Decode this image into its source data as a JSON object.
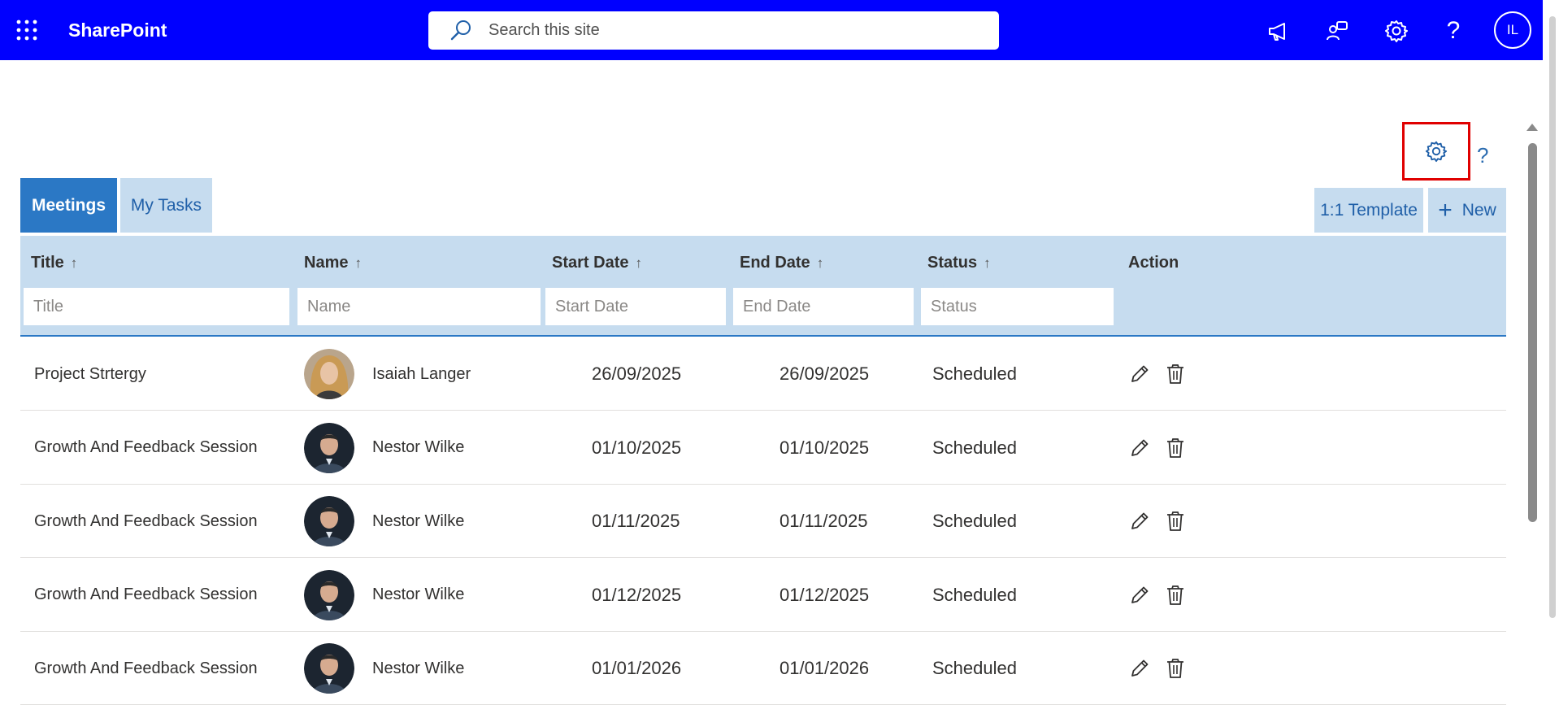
{
  "suitebar": {
    "app_name": "SharePoint",
    "search_placeholder": "Search this site",
    "user_initials": "IL",
    "icons": [
      "waffle-icon",
      "megaphone-icon",
      "feedback-icon",
      "gear-icon",
      "help-icon"
    ],
    "background": "#0000ff"
  },
  "webpart": {
    "help_label": "?",
    "tabs": [
      {
        "label": "Meetings",
        "active": true
      },
      {
        "label": "My Tasks",
        "active": false
      }
    ],
    "template_button": "1:1 Template",
    "new_button": "New",
    "accent": "#2b78c5",
    "light_accent": "#c6dcef",
    "highlight": "#e00000"
  },
  "table": {
    "columns": [
      {
        "label": "Title",
        "sort": "↑",
        "filter_placeholder": "Title"
      },
      {
        "label": "Name",
        "sort": "↑",
        "filter_placeholder": "Name"
      },
      {
        "label": "Start Date",
        "sort": "↑",
        "filter_placeholder": "Start Date"
      },
      {
        "label": "End Date",
        "sort": "↑",
        "filter_placeholder": "End Date"
      },
      {
        "label": "Status",
        "sort": "↑",
        "filter_placeholder": "Status"
      },
      {
        "label": "Action"
      }
    ],
    "rows": [
      {
        "title": "Project Strtergy",
        "name": "Isaiah Langer",
        "start": "26/09/2025",
        "end": "26/09/2025",
        "status": "Scheduled",
        "avatar": "female-avatar"
      },
      {
        "title": "Growth And Feedback Session",
        "name": "Nestor Wilke",
        "start": "01/10/2025",
        "end": "01/10/2025",
        "status": "Scheduled",
        "avatar": "male-avatar"
      },
      {
        "title": "Growth And Feedback Session",
        "name": "Nestor Wilke",
        "start": "01/11/2025",
        "end": "01/11/2025",
        "status": "Scheduled",
        "avatar": "male-avatar"
      },
      {
        "title": "Growth And Feedback Session",
        "name": "Nestor Wilke",
        "start": "01/12/2025",
        "end": "01/12/2025",
        "status": "Scheduled",
        "avatar": "male-avatar"
      },
      {
        "title": "Growth And Feedback Session",
        "name": "Nestor Wilke",
        "start": "01/01/2026",
        "end": "01/01/2026",
        "status": "Scheduled",
        "avatar": "male-avatar"
      }
    ]
  }
}
